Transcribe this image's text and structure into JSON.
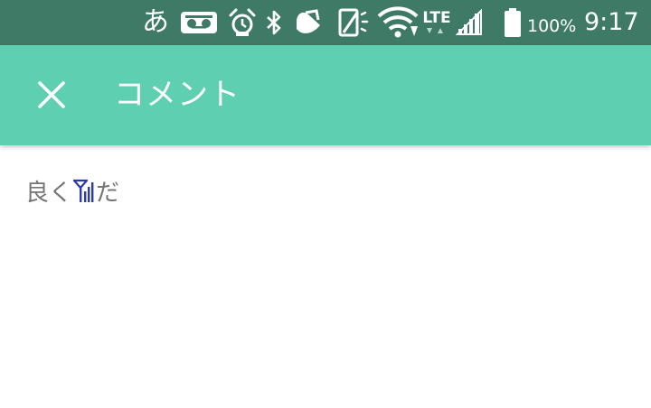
{
  "status_bar": {
    "ime_indicator": "あ",
    "icons": [
      "voicemail-icon",
      "alarm-icon",
      "bluetooth-icon",
      "app-notification-icon",
      "screen-rotation-icon",
      "wifi-icon",
      "lte-icon",
      "cell-signal-icon",
      "battery-icon"
    ],
    "lte_label": "LTE",
    "battery_percent": "100%",
    "time": "9:17"
  },
  "app_bar": {
    "title": "コメント",
    "close_icon": "close-icon"
  },
  "comment": {
    "text_before": "良く",
    "inline_icon": "antenna-signal-icon",
    "text_after": "だ"
  },
  "colors": {
    "status_bar_bg": "#3f7a67",
    "app_bar_bg": "#5fcfb2",
    "text": "#757575",
    "inline_icon": "#2a3bb0"
  }
}
